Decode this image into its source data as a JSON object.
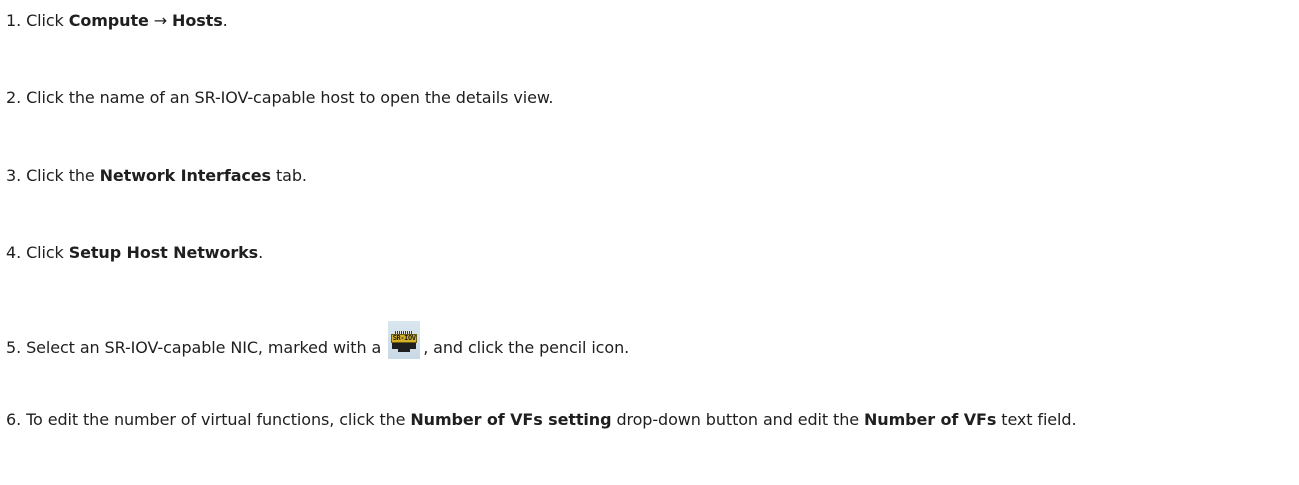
{
  "steps": [
    {
      "num": "1.",
      "parts": [
        "Click ",
        "Compute",
        " → ",
        "Hosts",
        "."
      ]
    },
    {
      "num": "2.",
      "text": "Click the name of an SR-IOV-capable host to open the details view."
    },
    {
      "num": "3.",
      "parts": [
        "Click the ",
        "Network Interfaces",
        " tab."
      ]
    },
    {
      "num": "4.",
      "parts": [
        "Click ",
        "Setup Host Networks",
        "."
      ]
    },
    {
      "num": "5.",
      "before_icon": "Select an SR-IOV-capable NIC, marked with a",
      "icon": "sr-iov-icon",
      "icon_label": "SR-IOV",
      "after_icon": ", and click the pencil icon."
    },
    {
      "num": "6.",
      "parts": [
        "To edit the number of virtual functions, click the ",
        "Number of VFs setting",
        " drop-down button and edit the ",
        "Number of VFs",
        " text field."
      ]
    }
  ]
}
